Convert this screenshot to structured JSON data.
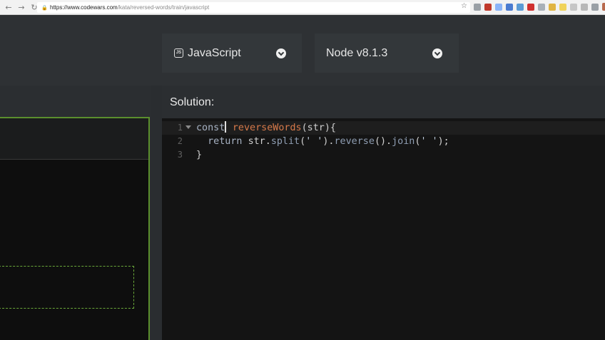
{
  "browser": {
    "url_scheme_host": "https://www.codewars.com",
    "url_path": "/kata/reversed-words/train/javascript",
    "extensions": [
      "ext-1",
      "ext-2",
      "ext-3",
      "ext-4",
      "ext-5",
      "ext-6",
      "ext-7",
      "ext-8",
      "ext-9",
      "ext-10",
      "ext-11",
      "ext-12"
    ]
  },
  "selectors": {
    "language": {
      "label": "JavaScript",
      "icon": "js-icon"
    },
    "runtime": {
      "label": "Node v8.1.3"
    }
  },
  "solution": {
    "title": "Solution:",
    "lines": [
      {
        "number": "1",
        "tokens": [
          [
            "kw",
            "const"
          ],
          [
            "cursor",
            ""
          ],
          [
            "sp",
            " "
          ],
          [
            "fn",
            "reverseWords"
          ],
          [
            "id",
            "(str){"
          ]
        ]
      },
      {
        "number": "2",
        "tokens": [
          [
            "sp",
            "  "
          ],
          [
            "kw",
            "return"
          ],
          [
            "sp",
            " "
          ],
          [
            "id",
            "str."
          ],
          [
            "mth",
            "split"
          ],
          [
            "id",
            "("
          ],
          [
            "str",
            "' '"
          ],
          [
            "id",
            ")."
          ],
          [
            "mth",
            "reverse"
          ],
          [
            "id",
            "()."
          ],
          [
            "mth",
            "join"
          ],
          [
            "id",
            "("
          ],
          [
            "str",
            "' '"
          ],
          [
            "id",
            ");"
          ]
        ]
      },
      {
        "number": "3",
        "tokens": [
          [
            "id",
            "}"
          ]
        ]
      }
    ]
  },
  "colors": {
    "accent_green": "#5b8f2d",
    "editor_bg": "#141414",
    "function_name": "#d87a4a"
  }
}
